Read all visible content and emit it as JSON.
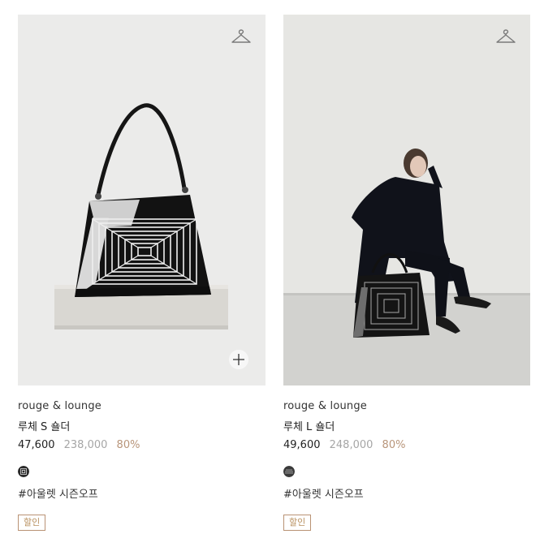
{
  "products": [
    {
      "brand": "rouge & lounge",
      "name": "루체 S 숄더",
      "price_sale": "47,600",
      "price_original": "238,000",
      "discount": "80%",
      "tag": "#아울렛 시즌오프",
      "badge": "할인",
      "icons": [
        "hanger-icon",
        "plus-icon"
      ]
    },
    {
      "brand": "rouge & lounge",
      "name": "루체 L 숄더",
      "price_sale": "49,600",
      "price_original": "248,000",
      "discount": "80%",
      "tag": "#아울렛 시즌오프",
      "badge": "할인",
      "icons": [
        "hanger-icon"
      ]
    }
  ],
  "colors": {
    "discount": "#b8957a",
    "original_price": "#a6a6a6",
    "badge_border": "#b99274"
  }
}
